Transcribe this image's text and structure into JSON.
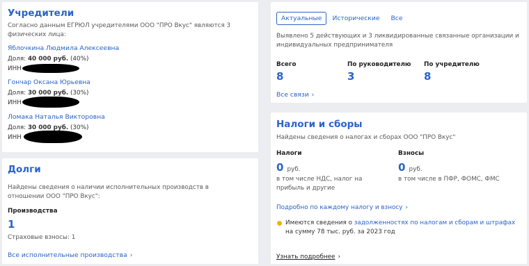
{
  "founders": {
    "title": "Учредители",
    "intro": "Согласно данным ЕГРЮЛ учредителями ООО \"ПРО Вкус\" являются 3 физических лица:",
    "share_label": "Доля:",
    "inn_label": "ИНН",
    "people": [
      {
        "name": "Яблочкина Людмила Алексеевна",
        "amount": "40 000 руб.",
        "percent": "(40%)"
      },
      {
        "name": "Гончар Оксана Юрьевна",
        "amount": "30 000 руб.",
        "percent": "(30%)"
      },
      {
        "name": "Ломака Наталья Викторовна",
        "amount": "30 000 руб.",
        "percent": "(30%)"
      }
    ]
  },
  "debts": {
    "title": "Долги",
    "intro": "Найдены сведения о наличии исполнительных производств в отношении ООО \"ПРО Вкус\":",
    "proceedings_label": "Производства",
    "proceedings_count": "1",
    "insurance_note": "Страховые взносы: 1",
    "all_link": "Все исполнительные производства"
  },
  "connections": {
    "tabs": [
      "Актуальные",
      "Исторические",
      "Все"
    ],
    "active_tab": "Актуальные",
    "intro": "Выявлено 5 действующих и 3 ликвидированные связанные организации и индивидуальных предпринимателя",
    "stats": [
      {
        "label": "Всего",
        "value": "8"
      },
      {
        "label": "По руководителю",
        "value": "3"
      },
      {
        "label": "По учредителю",
        "value": "8"
      }
    ],
    "all_link": "Все связи"
  },
  "taxes": {
    "title": "Налоги и сборы",
    "intro": "Найдены сведения о налогах и сборах ООО \"ПРО Вкус\"",
    "taxes_label": "Налоги",
    "taxes_value": "0",
    "taxes_unit": "руб.",
    "taxes_note": "в том числе НДС, налог на прибыль и другие",
    "contrib_label": "Взносы",
    "contrib_value": "0",
    "contrib_unit": "руб.",
    "contrib_note": "в том числе в ПФР, ФОМС, ФМС",
    "detail_link": "Подробно по каждому налогу и взносу",
    "debt_prefix": "Имеются сведения о",
    "debt_link": "задолженностях по налогам и сборам и штрафах",
    "debt_suffix": "на сумму 78 тыс. руб. за 2023 год",
    "more_link": "Узнать подробнее"
  },
  "colors": {
    "accent": "#2a63c8",
    "background": "#ecedf0",
    "warning_dot": "#f0b400"
  }
}
